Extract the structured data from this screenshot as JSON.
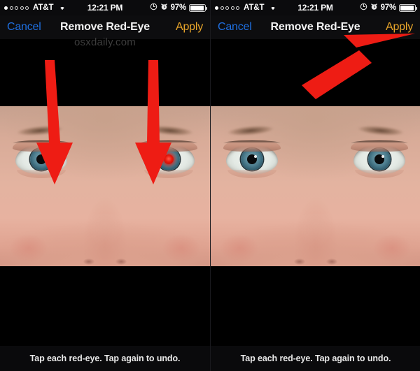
{
  "panels": [
    {
      "id": "before",
      "statusbar": {
        "signal_dots_total": 5,
        "signal_dots_filled": 1,
        "carrier": "AT&T",
        "wifi_icon": "wifi-icon",
        "time": "12:21 PM",
        "rotation_lock_icon": "rotation-lock-icon",
        "alarm_icon": "alarm-clock-icon",
        "battery_percent": "97%",
        "battery_level": 97
      },
      "navbar": {
        "cancel_label": "Cancel",
        "title": "Remove Red-Eye",
        "apply_label": "Apply",
        "cancel_color": "#1f6fe0",
        "apply_color": "#e8a52a"
      },
      "watermark": "osxdaily.com",
      "photo": {
        "left_eye_pupil": "fixed-dark",
        "right_eye_pupil": "red-eye"
      },
      "annotations": [
        {
          "name": "arrow-to-left-eye",
          "direction": "down",
          "color": "#ee1c14"
        },
        {
          "name": "arrow-to-right-eye",
          "direction": "down",
          "color": "#ee1c14"
        }
      ],
      "caption": "Tap each red-eye. Tap again to undo."
    },
    {
      "id": "after",
      "statusbar": {
        "signal_dots_total": 5,
        "signal_dots_filled": 1,
        "carrier": "AT&T",
        "wifi_icon": "wifi-icon",
        "time": "12:21 PM",
        "rotation_lock_icon": "rotation-lock-icon",
        "alarm_icon": "alarm-clock-icon",
        "battery_percent": "97%",
        "battery_level": 97
      },
      "navbar": {
        "cancel_label": "Cancel",
        "title": "Remove Red-Eye",
        "apply_label": "Apply",
        "cancel_color": "#1f6fe0",
        "apply_color": "#e8a52a"
      },
      "watermark": "",
      "photo": {
        "left_eye_pupil": "fixed-dark",
        "right_eye_pupil": "fixed-dark"
      },
      "annotations": [
        {
          "name": "arrow-to-apply-button",
          "direction": "up-right",
          "color": "#ee1c14"
        }
      ],
      "caption": "Tap each red-eye. Tap again to undo."
    }
  ]
}
